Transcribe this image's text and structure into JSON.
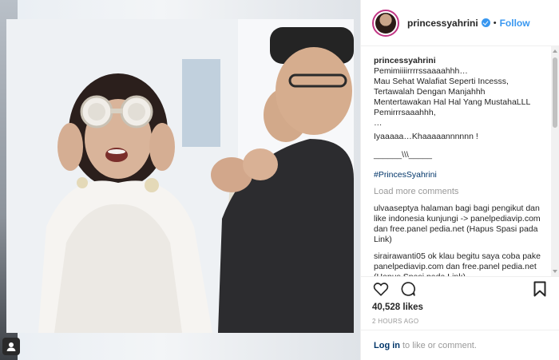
{
  "post": {
    "username": "princessyahrini",
    "separator": "•",
    "follow_label": "Follow",
    "caption": {
      "username": "princessyahrini",
      "lines": [
        "Pemimiiiirrrrssaaaahhh…",
        "Mau Sehat Walafiat Seperti Incesss,",
        "Tertawalah Dengan Manjahhh",
        "Mentertawakan Hal Hal Yang MustahaLLL",
        "Pemirrrsaaahhh,",
        "…",
        "Iyaaaaa…Khaaaaannnnnn !",
        "______\\\\\\_____"
      ],
      "hashtag": "#PrincesSyahrini"
    },
    "load_more_label": "Load more comments",
    "comments": [
      {
        "user": "ulvaaseptya",
        "text": "halaman bagi bagi pengikut dan like indonesia kunjungi -> panelpediavip.com dan free.panel pedia.net (Hapus Spasi pada Link)"
      },
      {
        "user": "sirairawanti05",
        "text": "ok klau begitu saya coba pake panelpediavip.com dan free.panel pedia.net (Hapus Spasi pada Link)"
      }
    ],
    "likes": "40,528 likes",
    "time": "2 HOURS AGO",
    "footer": {
      "login": "Log in",
      "rest": "to like or comment."
    }
  },
  "icons": {
    "verified": "verified-badge-icon",
    "like": "heart-icon",
    "comment": "comment-bubble-icon",
    "save": "bookmark-icon",
    "camera": "camera-icon",
    "more": "more-dots-icon"
  },
  "colors": {
    "link_blue": "#3897f0",
    "hashtag_blue": "#003569",
    "muted": "#999999",
    "text": "#262626"
  }
}
